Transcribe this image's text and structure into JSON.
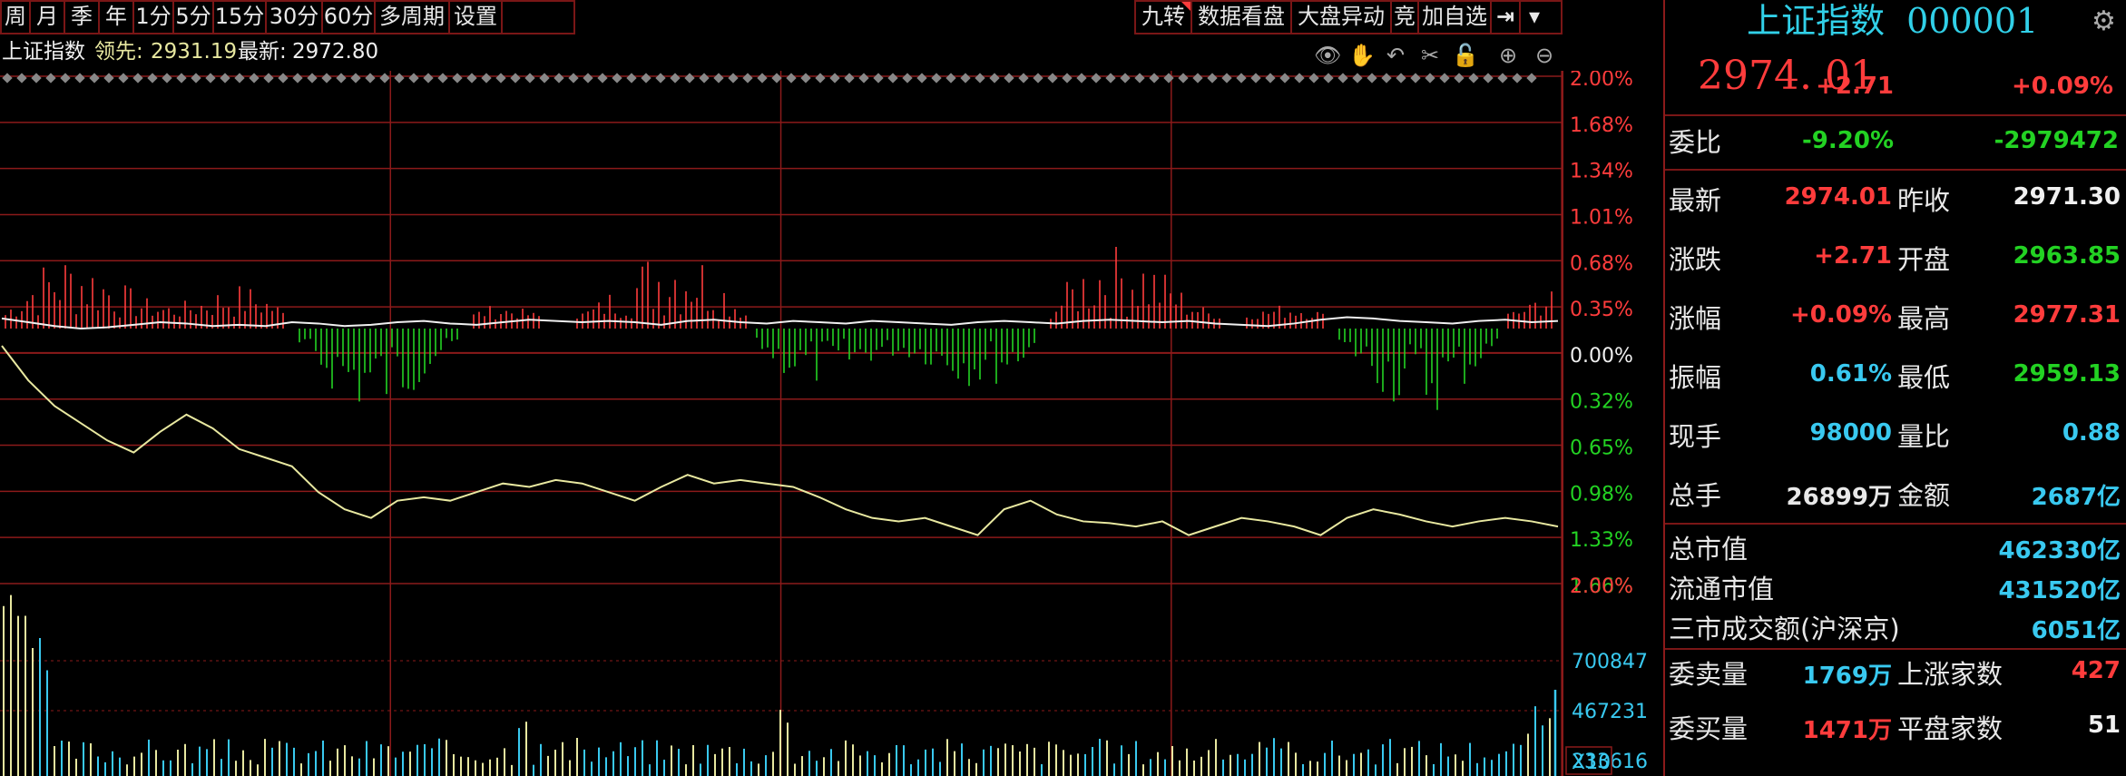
{
  "toolbar": {
    "left": [
      "周",
      "月",
      "季",
      "年",
      "1分",
      "5分",
      "15分",
      "30分",
      "60分",
      "多周期",
      "设置"
    ],
    "right": [
      "九转",
      "数据看盘",
      "大盘异动",
      "竞",
      "加自选"
    ]
  },
  "info": {
    "name": "上证指数",
    "lead_label": "领先:",
    "lead_value": "2931.19",
    "latest_label": "最新:",
    "latest_value": "2972.80"
  },
  "price_axis": [
    "2.00%",
    "1.68%",
    "1.34%",
    "1.01%",
    "0.68%",
    "0.35%",
    "0.00%",
    "0.32%",
    "0.65%",
    "0.98%",
    "1.33%",
    "1.66%",
    "2.00%"
  ],
  "volume_axis": [
    "700847",
    "467231",
    "233616"
  ],
  "volume_multiplier": "X10",
  "colors": {
    "up": "#ff3c3c",
    "down": "#23d223",
    "white_line": "#f0f0f0",
    "yellow_line": "#e8e8a0",
    "grid": "#8b1a1a",
    "cyan": "#39c9f0",
    "title": "#31d0e8"
  },
  "chart_data": {
    "type": "line",
    "series": [
      {
        "values": [
          0.08,
          0.05,
          0.02,
          0.0,
          0.01,
          0.03,
          0.05,
          0.04,
          0.02,
          0.03,
          0.02,
          0.05,
          0.04,
          0.02,
          0.03,
          0.05,
          0.06,
          0.04,
          0.03,
          0.05,
          0.07,
          0.06,
          0.05,
          0.06,
          0.05,
          0.03,
          0.06,
          0.07,
          0.05,
          0.04,
          0.06,
          0.05,
          0.04,
          0.06,
          0.05,
          0.04,
          0.03,
          0.05,
          0.06,
          0.05,
          0.04,
          0.06,
          0.07,
          0.06,
          0.05,
          0.06,
          0.04,
          0.03,
          0.02,
          0.04,
          0.07,
          0.09,
          0.08,
          0.06,
          0.05,
          0.04,
          0.06,
          0.07,
          0.05,
          0.06
        ]
      },
      {
        "values": [
          -0.1,
          -0.3,
          -0.45,
          -0.55,
          -0.65,
          -0.72,
          -0.6,
          -0.5,
          -0.58,
          -0.7,
          -0.75,
          -0.8,
          -0.95,
          -1.05,
          -1.1,
          -1.0,
          -0.98,
          -1.0,
          -0.95,
          -0.9,
          -0.92,
          -0.88,
          -0.9,
          -0.95,
          -1.0,
          -0.92,
          -0.85,
          -0.9,
          -0.88,
          -0.9,
          -0.92,
          -0.98,
          -1.05,
          -1.1,
          -1.12,
          -1.1,
          -1.15,
          -1.2,
          -1.05,
          -1.0,
          -1.08,
          -1.12,
          -1.13,
          -1.15,
          -1.12,
          -1.2,
          -1.15,
          -1.1,
          -1.12,
          -1.15,
          -1.2,
          -1.1,
          -1.05,
          -1.08,
          -1.12,
          -1.15,
          -1.12,
          -1.1,
          -1.12,
          -1.15
        ]
      }
    ],
    "ylim": [
      -2.0,
      2.0
    ]
  },
  "panel": {
    "title": "上证指数",
    "code": "000001",
    "price": "2974. 01",
    "change": "+2.71",
    "change_pct": "+0.09%",
    "weibi_label": "委比",
    "weibi_pct": "-9.20%",
    "weibi_val": "-2979472",
    "rows": [
      {
        "l1": "最新",
        "v1": "2974.01",
        "c1": "#ff3c3c",
        "l2": "昨收",
        "v2": "2971.30",
        "c2": "#f0f0f0"
      },
      {
        "l1": "涨跌",
        "v1": "+2.71",
        "c1": "#ff3c3c",
        "l2": "开盘",
        "v2": "2963.85",
        "c2": "#23d223"
      },
      {
        "l1": "涨幅",
        "v1": "+0.09%",
        "c1": "#ff3c3c",
        "l2": "最高",
        "v2": "2977.31",
        "c2": "#ff3c3c"
      },
      {
        "l1": "振幅",
        "v1": "0.61%",
        "c1": "#39c9f0",
        "l2": "最低",
        "v2": "2959.13",
        "c2": "#23d223"
      },
      {
        "l1": "现手",
        "v1": "98000",
        "c1": "#39c9f0",
        "l2": "量比",
        "v2": "0.88",
        "c2": "#39c9f0"
      },
      {
        "l1": "总手",
        "v1": "26899万",
        "c1": "#e8e8e8",
        "l2": "金额",
        "v2": "2687亿",
        "c2": "#39c9f0"
      }
    ],
    "cap_rows": [
      {
        "l": "总市值",
        "v": "462330亿"
      },
      {
        "l": "流通市值",
        "v": "431520亿"
      },
      {
        "l": "三市成交额(沪深京)",
        "v": "6051亿"
      }
    ],
    "bottom_rows": [
      {
        "l1": "委卖量",
        "v1": "1769万",
        "c1": "#39c9f0",
        "l2": "上涨家数",
        "v2": "427",
        "c2": "#ff3c3c"
      },
      {
        "l1": "委买量",
        "v1": "1471万",
        "c1": "#ff3c3c",
        "l2": "平盘家数",
        "v2": "51",
        "c2": "#f0f0f0"
      }
    ]
  }
}
